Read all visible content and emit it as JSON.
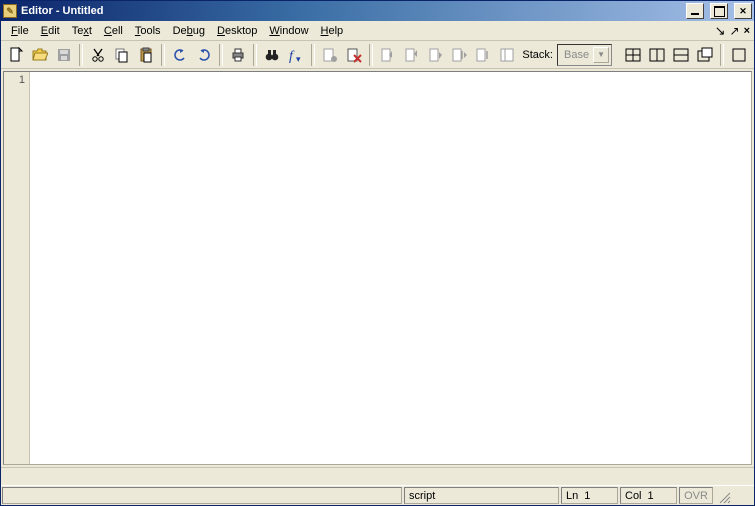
{
  "title": "Editor - Untitled",
  "menus": {
    "file": "File",
    "edit": "Edit",
    "text": "Text",
    "cell": "Cell",
    "tools": "Tools",
    "debug": "Debug",
    "desktop": "Desktop",
    "window": "Window",
    "help": "Help"
  },
  "toolbar": {
    "stack_label": "Stack:",
    "stack_value": "Base"
  },
  "gutter": {
    "line1": "1"
  },
  "status": {
    "mode": "script",
    "ln_label": "Ln",
    "ln_val": "1",
    "col_label": "Col",
    "col_val": "1",
    "ovr": "OVR"
  }
}
